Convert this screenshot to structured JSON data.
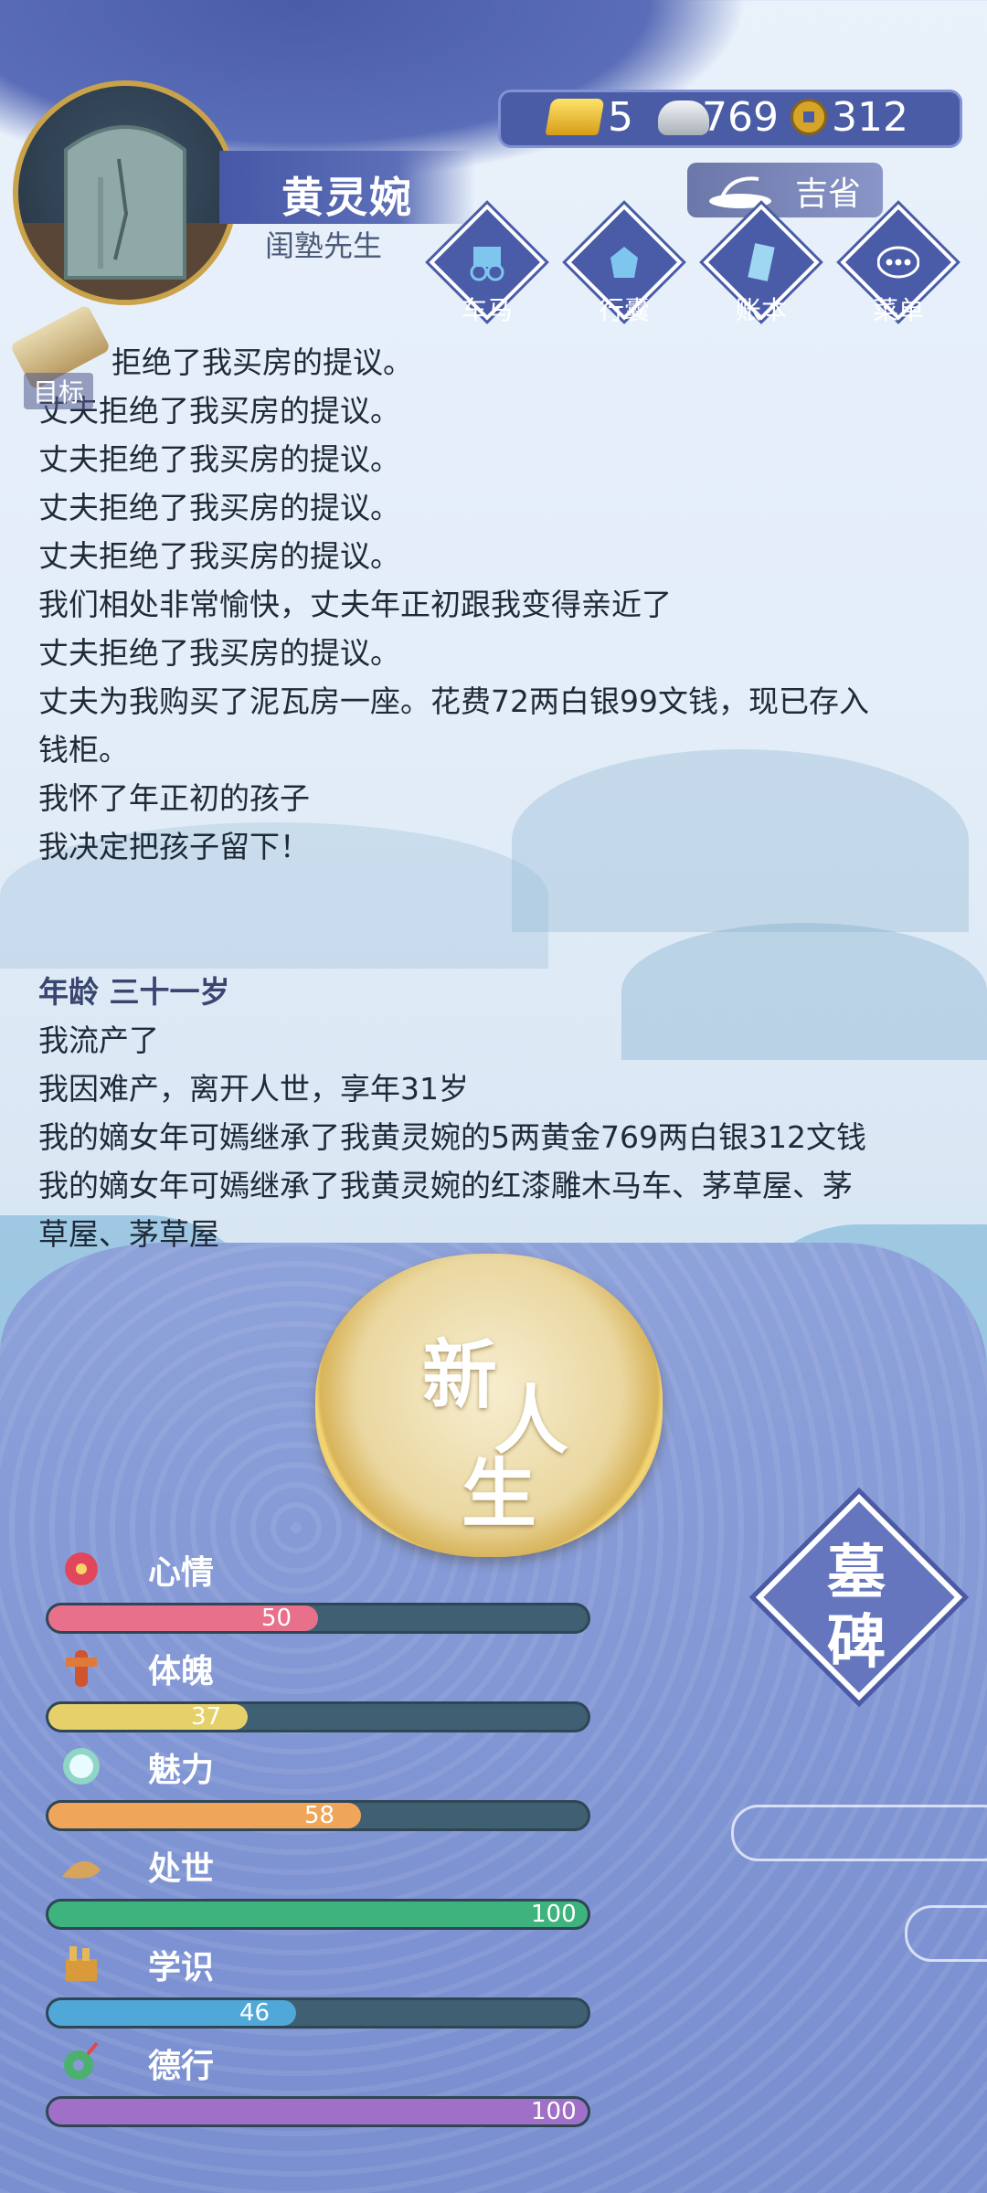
{
  "character": {
    "name": "黄灵婉",
    "title": "闺塾先生"
  },
  "currency": {
    "gold": "5",
    "silver": "769",
    "copper": "312"
  },
  "fortune": {
    "label": "吉省"
  },
  "menu": [
    {
      "label": "车马",
      "icon": "carriage-icon"
    },
    {
      "label": "行囊",
      "icon": "bundle-icon"
    },
    {
      "label": "账本",
      "icon": "ledger-icon"
    },
    {
      "label": "菜单",
      "icon": "more-icon"
    }
  ],
  "target": {
    "label": "目标"
  },
  "log": {
    "lines": [
      "拒绝了我买房的提议。",
      "丈夫拒绝了我买房的提议。",
      "丈夫拒绝了我买房的提议。",
      "丈夫拒绝了我买房的提议。",
      "丈夫拒绝了我买房的提议。",
      "我们相处非常愉快，丈夫年正初跟我变得亲近了",
      "丈夫拒绝了我买房的提议。",
      "丈夫为我购买了泥瓦房一座。花费72两白银99文钱，现已存入",
      "钱柜。",
      "我怀了年正初的孩子",
      "我决定把孩子留下！"
    ],
    "age_header": "年龄 三十一岁",
    "age_lines": [
      "我流产了",
      "我因难产，离开人世，享年31岁",
      "我的嫡女年可嫣继承了我黄灵婉的5两黄金769两白银312文钱",
      "我的嫡女年可嫣继承了我黄灵婉的红漆雕木马车、茅草屋、茅",
      "草屋、茅草屋"
    ]
  },
  "new_life": {
    "chars": [
      "新",
      "人",
      "生"
    ]
  },
  "tomb": {
    "chars": [
      "墓",
      "碑"
    ]
  },
  "stats": [
    {
      "label": "心情",
      "value": 50,
      "display": "50",
      "color": "#e8708a",
      "icon": "flower-icon"
    },
    {
      "label": "体魄",
      "value": 37,
      "display": "37",
      "color": "#e6d06a",
      "icon": "fitness-icon"
    },
    {
      "label": "魅力",
      "value": 58,
      "display": "58",
      "color": "#f0a65a",
      "icon": "mirror-icon"
    },
    {
      "label": "处世",
      "value": 100,
      "display": "100",
      "color": "#3fb37e",
      "icon": "hat-icon"
    },
    {
      "label": "学识",
      "value": 46,
      "display": "46",
      "color": "#4fa8d8",
      "icon": "books-icon"
    },
    {
      "label": "德行",
      "value": 100,
      "display": "100",
      "color": "#a070c8",
      "icon": "jade-icon"
    }
  ]
}
